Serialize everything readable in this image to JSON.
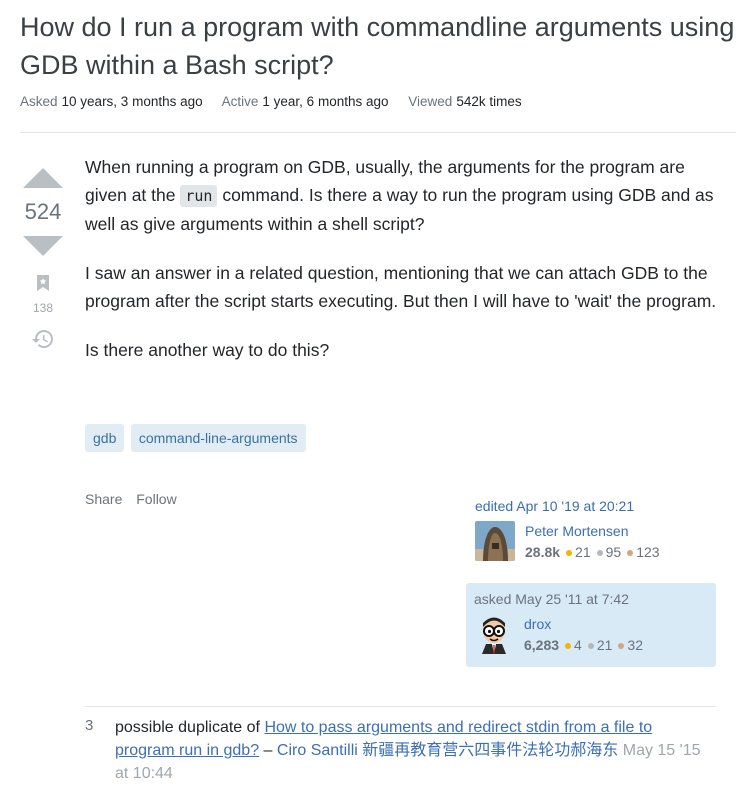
{
  "question": {
    "title": "How do I run a program with commandline arguments using GDB within a Bash script?",
    "asked_label": "Asked",
    "asked_value": "10 years, 3 months ago",
    "active_label": "Active",
    "active_value": "1 year, 6 months ago",
    "viewed_label": "Viewed",
    "viewed_value": "542k times",
    "score": "524",
    "bookmark_count": "138",
    "body": {
      "p1_a": "When running a program on GDB, usually, the arguments for the program are given at the",
      "p1_code": "run",
      "p1_b": "command. Is there a way to run the program using GDB and as well as give arguments within a shell script?",
      "p2": "I saw an answer in a related question, mentioning that we can attach GDB to the program after the script starts executing. But then I will have to 'wait' the program.",
      "p3": "Is there another way to do this?"
    },
    "tags": [
      "gdb",
      "command-line-arguments"
    ],
    "share_label": "Share",
    "follow_label": "Follow"
  },
  "editor": {
    "time": "edited Apr 10 '19 at 20:21",
    "name": "Peter Mortensen",
    "rep": "28.8k",
    "gold": "21",
    "silver": "95",
    "bronze": "123"
  },
  "asker": {
    "time": "asked May 25 '11 at 7:42",
    "name": "drox",
    "rep": "6,283",
    "gold": "4",
    "silver": "21",
    "bronze": "32"
  },
  "comment": {
    "score": "3",
    "prefix": "possible duplicate of",
    "link": "How to pass arguments and redirect stdin from a file to program run in gdb?",
    "dash": "–",
    "user": "Ciro Santilli 新疆再教育营六四事件法轮功郝海东",
    "date": "May 15 '15 at 10:44"
  },
  "colors": {
    "link": "#3b6fb6",
    "tag_bg": "#e1ecf4",
    "tag_text": "#39739d",
    "owner_bg": "#d9eaf7",
    "gold": "#f1b600",
    "silver": "#b4b8bc",
    "bronze": "#d1a684"
  },
  "icons": [
    "upvote-arrow",
    "downvote-arrow",
    "bookmark-icon",
    "history-icon"
  ]
}
